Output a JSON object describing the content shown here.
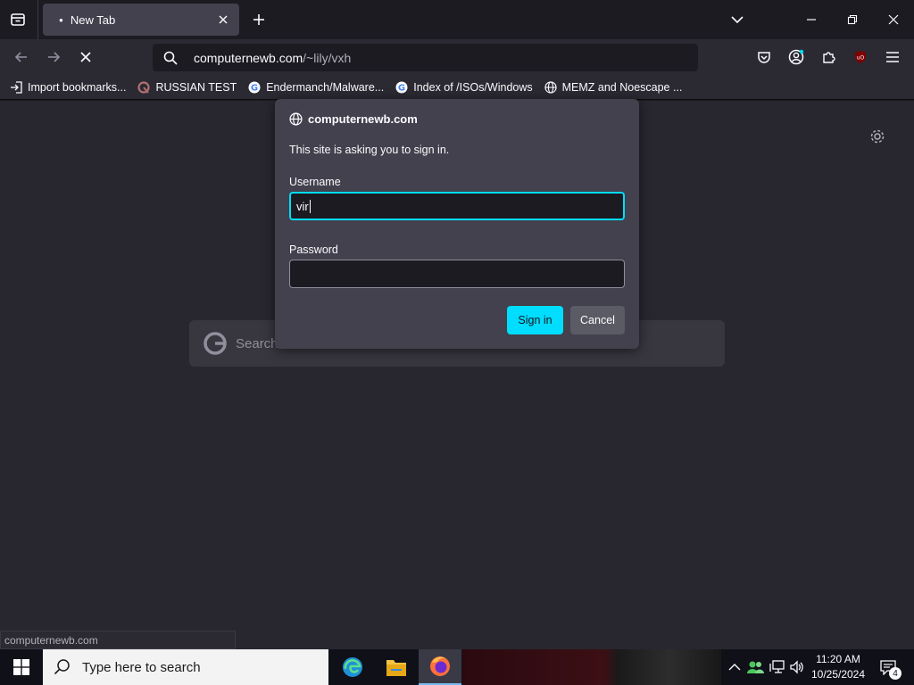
{
  "browser": {
    "tab": {
      "title": "New Tab"
    },
    "urlbar": {
      "host": "computernewb.com",
      "path": "/~lily/vxh"
    }
  },
  "bookmarks": [
    {
      "label": "Import bookmarks...",
      "icon": "import-icon"
    },
    {
      "label": "RUSSIAN TEST",
      "icon": "favicon-icon"
    },
    {
      "label": "Endermanch/Malware...",
      "icon": "google-icon"
    },
    {
      "label": "Index of /ISOs/Windows",
      "icon": "google-icon"
    },
    {
      "label": "MEMZ and Noescape ...",
      "icon": "globe-icon"
    }
  ],
  "newtab": {
    "search_placeholder": "Search"
  },
  "auth_dialog": {
    "origin": "computernewb.com",
    "message": "This site is asking you to sign in.",
    "username_label": "Username",
    "username_value": "vir",
    "password_label": "Password",
    "password_value": "",
    "signin_label": "Sign in",
    "cancel_label": "Cancel"
  },
  "statusbar": {
    "text": "computernewb.com"
  },
  "taskbar": {
    "search_placeholder": "Type here to search",
    "time": "11:20 AM",
    "date": "10/25/2024",
    "notification_count": "4"
  },
  "colors": {
    "accent": "#00ddff",
    "toolbar": "#2b2a33",
    "content": "#28272f",
    "dialog": "#42414d"
  }
}
